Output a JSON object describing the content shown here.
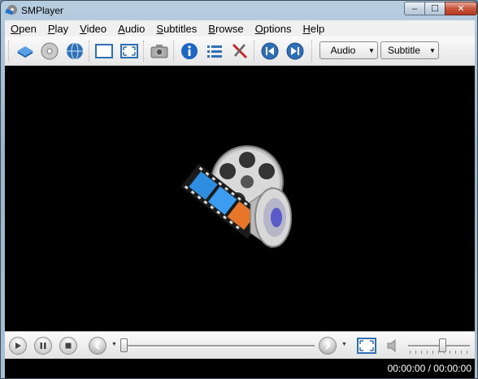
{
  "window": {
    "title": "SMPlayer",
    "min_label": "–",
    "max_label": "☐",
    "close_label": "✕"
  },
  "menu": {
    "items": [
      {
        "key": "O",
        "rest": "pen"
      },
      {
        "key": "P",
        "rest": "lay"
      },
      {
        "key": "V",
        "rest": "ideo"
      },
      {
        "key": "A",
        "rest": "udio"
      },
      {
        "key": "S",
        "rest": "ubtitles"
      },
      {
        "key": "B",
        "rest": "rowse"
      },
      {
        "key": "O",
        "rest": "ptions"
      },
      {
        "key": "H",
        "rest": "elp"
      }
    ]
  },
  "toolbar": {
    "icons": [
      "open-file-icon",
      "open-dvd-icon",
      "open-url-icon",
      "compact-mode-icon",
      "fullscreen-icon",
      "screenshot-icon",
      "info-icon",
      "playlist-icon",
      "preferences-icon",
      "previous-icon",
      "next-icon"
    ],
    "audio_combo": "Audio",
    "subtitle_combo": "Subtitle"
  },
  "status": {
    "time": "00:00:00 / 00:00:00"
  },
  "seek": {
    "position": 0
  },
  "volume": {
    "level": 0.55
  },
  "colors": {
    "video_bg": "#000000",
    "accent": "#2e6fb5"
  }
}
